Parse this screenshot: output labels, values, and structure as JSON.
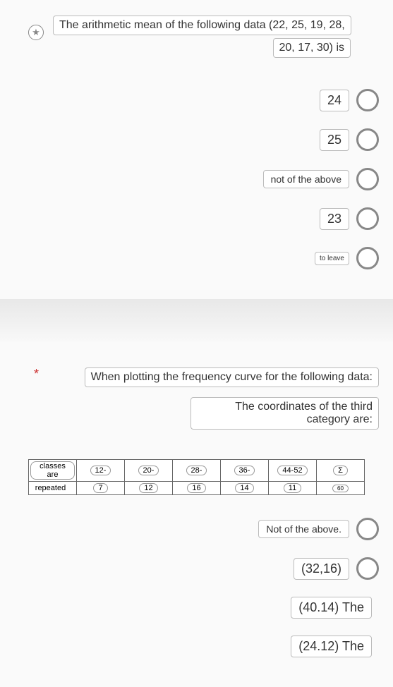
{
  "q1": {
    "star": "★",
    "text_line1": "The arithmetic mean of the following data (22, 25, 19, 28,",
    "text_line2": "20, 17, 30) is",
    "options": [
      {
        "label": "24",
        "size": "normal"
      },
      {
        "label": "25",
        "size": "normal"
      },
      {
        "label": "not of the above",
        "size": "medium"
      },
      {
        "label": "23",
        "size": "normal"
      },
      {
        "label": "to leave",
        "size": "small"
      }
    ]
  },
  "q2": {
    "star": "*",
    "text_line1": "When plotting the frequency curve for the following data:",
    "text_line2": "The coordinates of the third category are:",
    "table": {
      "header_row": [
        "classes are",
        "12-",
        "20-",
        "28-",
        "36-",
        "44-52",
        "Σ"
      ],
      "data_row": [
        "repeated",
        "7",
        "12",
        "16",
        "14",
        "11",
        "60"
      ]
    },
    "options": [
      {
        "label": "Not of the above.",
        "size": "medium",
        "radio": true
      },
      {
        "label": "(32,16)",
        "size": "normal",
        "radio": true
      },
      {
        "label": "(40.14) The",
        "size": "normal",
        "radio": false
      },
      {
        "label": "(24.12) The",
        "size": "normal",
        "radio": false
      }
    ]
  },
  "chart_data": {
    "type": "table",
    "title": "Frequency distribution",
    "categories": [
      "12-",
      "20-",
      "28-",
      "36-",
      "44-52"
    ],
    "values": [
      7,
      12,
      16,
      14,
      11
    ],
    "total": 60,
    "row_labels": [
      "classes are",
      "repeated"
    ]
  }
}
